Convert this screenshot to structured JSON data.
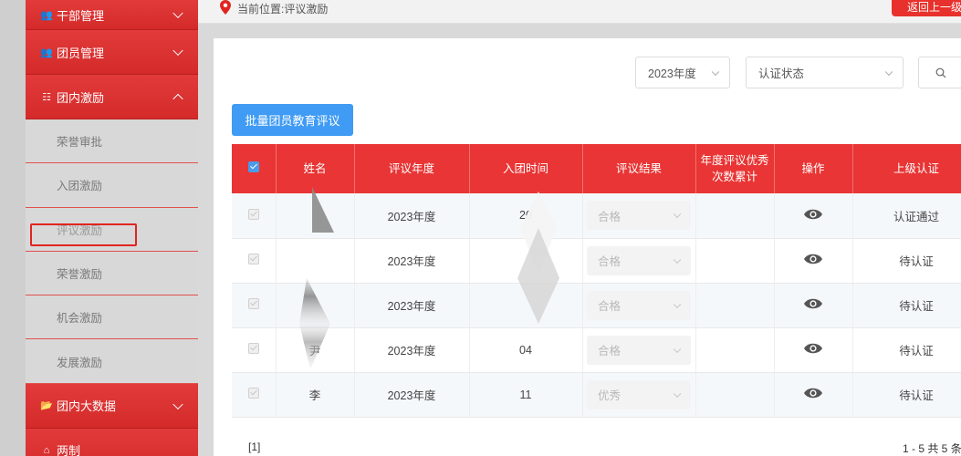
{
  "sidebar": {
    "groups": [
      {
        "label": "干部管理",
        "icon": "users-icon"
      },
      {
        "label": "团员管理",
        "icon": "users-icon"
      },
      {
        "label": "团内激励",
        "icon": "sitemap-icon"
      },
      {
        "label": "团内大数据",
        "icon": "folder-open-icon"
      },
      {
        "label": "两制",
        "icon": "home-icon"
      }
    ],
    "sub_items": [
      "荣誉审批",
      "入团激励",
      "评议激励",
      "荣誉激励",
      "机会激励",
      "发展激励"
    ],
    "active_sub_item": "评议激励"
  },
  "breadcrumb": {
    "text": "当前位置:评议激励"
  },
  "header": {
    "back_label": "返回上一级"
  },
  "filters": {
    "year_value": "2023年度",
    "status_placeholder": "认证状态"
  },
  "toolbar": {
    "batch_label": "批量团员教育评议"
  },
  "table": {
    "headers": [
      "姓名",
      "评议年度",
      "入团时间",
      "评议结果",
      "年度评议优秀次数累计",
      "操作",
      "上级认证"
    ],
    "header_count_line1": "年度评议优秀",
    "header_count_line2": "次数累计",
    "rows": [
      {
        "name": "",
        "year": "2023年度",
        "join_time": "20",
        "result": "合格",
        "count": "",
        "cert": "认证通过"
      },
      {
        "name": "",
        "year": "2023年度",
        "join_time": "",
        "result": "合格",
        "count": "",
        "cert": "待认证"
      },
      {
        "name": "",
        "year": "2023年度",
        "join_time": "",
        "result": "合格",
        "count": "",
        "cert": "待认证"
      },
      {
        "name": "尹",
        "year": "2023年度",
        "join_time": "04",
        "result": "合格",
        "count": "",
        "cert": "待认证"
      },
      {
        "name": "李",
        "year": "2023年度",
        "join_time": "11",
        "result": "优秀",
        "count": "",
        "cert": "待认证"
      }
    ]
  },
  "pagination": {
    "pages": "[1]",
    "summary": "1 - 5  共 5 条"
  },
  "colors": {
    "brand_red": "#e93535",
    "primary_blue": "#3f9bf4",
    "highlight_red": "#e0251f"
  }
}
